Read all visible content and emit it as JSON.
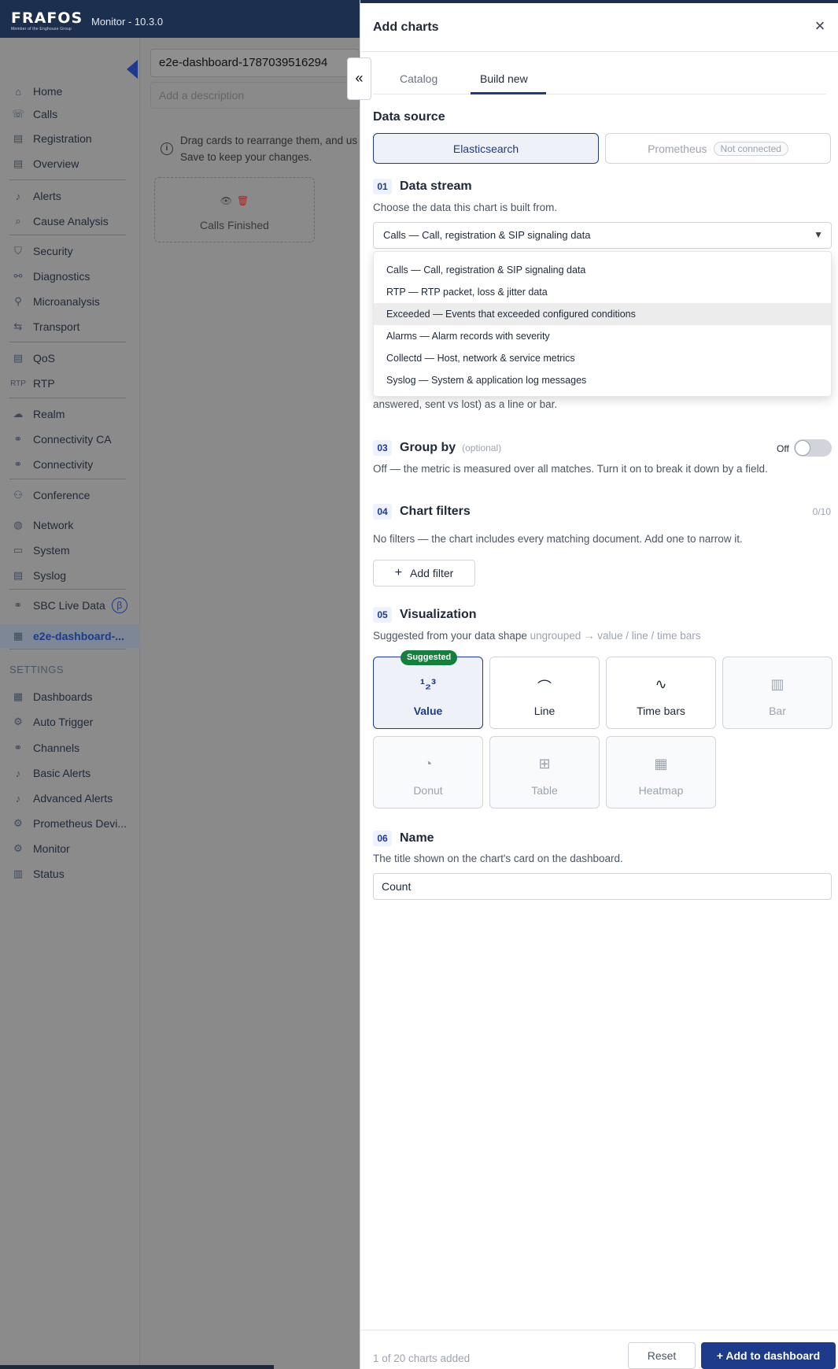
{
  "app": {
    "logo": "FRAFOS",
    "logo_sub": "Member of the Enghouse Group",
    "version": "Monitor - 10.3.0"
  },
  "sidebar": {
    "items": [
      {
        "label": "Home",
        "icon": "home-icon"
      },
      {
        "label": "Calls",
        "icon": "phone-icon"
      },
      {
        "label": "Registration",
        "icon": "registration-icon"
      },
      {
        "label": "Overview",
        "icon": "overview-icon"
      },
      {
        "label": "Alerts",
        "icon": "bell-icon"
      },
      {
        "label": "Cause Analysis",
        "icon": "search-icon"
      },
      {
        "label": "Security",
        "icon": "shield-icon"
      },
      {
        "label": "Diagnostics",
        "icon": "diagnostics-icon"
      },
      {
        "label": "Microanalysis",
        "icon": "microanalysis-icon"
      },
      {
        "label": "Transport",
        "icon": "transport-icon"
      },
      {
        "label": "QoS",
        "icon": "qos-icon"
      },
      {
        "label": "RTP",
        "icon": "rtp-icon"
      },
      {
        "label": "Realm",
        "icon": "cloud-icon"
      },
      {
        "label": "Connectivity CA",
        "icon": "connectivity-icon"
      },
      {
        "label": "Connectivity",
        "icon": "connectivity-icon"
      },
      {
        "label": "Conference",
        "icon": "conference-icon"
      },
      {
        "label": "Network",
        "icon": "globe-icon"
      },
      {
        "label": "System",
        "icon": "monitor-icon"
      },
      {
        "label": "Syslog",
        "icon": "log-icon"
      },
      {
        "label": "SBC Live Data",
        "icon": "live-data-icon",
        "badge": "β"
      },
      {
        "label": "e2e-dashboard-...",
        "icon": "dashboard-icon"
      }
    ],
    "settings_header": "SETTINGS",
    "settings_items": [
      {
        "label": "Dashboards",
        "icon": "dashboard-icon"
      },
      {
        "label": "Auto Trigger",
        "icon": "gear-icon"
      },
      {
        "label": "Channels",
        "icon": "channels-icon"
      },
      {
        "label": "Basic Alerts",
        "icon": "bell-icon"
      },
      {
        "label": "Advanced Alerts",
        "icon": "bell-icon"
      },
      {
        "label": "Prometheus Devi...",
        "icon": "gear-icon"
      },
      {
        "label": "Monitor",
        "icon": "gear-icon"
      },
      {
        "label": "Status",
        "icon": "status-icon"
      }
    ]
  },
  "main": {
    "dashboard_title": "e2e-dashboard-1787039516294",
    "description_placeholder": "Add a description",
    "hint_line1": "Drag cards to rearrange them, and us",
    "hint_line2": "Save to keep your changes.",
    "placeholder_card_label": "Calls Finished",
    "drawer_toggle": "«"
  },
  "drawer": {
    "title": "Add charts",
    "close": "×",
    "tabs": [
      "Catalog",
      "Build new"
    ],
    "active_tab": "Build new",
    "data_source": {
      "heading": "Data source",
      "elasticsearch": "Elasticsearch",
      "prometheus": "Prometheus",
      "prometheus_badge": "Not connected"
    },
    "data_stream": {
      "step": "01",
      "heading": "Data stream",
      "subtitle": "Choose the data this chart is built from.",
      "selected": "Calls — Call, registration & SIP signaling data",
      "options": [
        "Calls — Call, registration & SIP signaling data",
        "RTP — RTP packet, loss & jitter data",
        "Exceeded — Events that exceeded configured conditions",
        "Alarms — Alarm records with severity",
        "Collectd — Host, network & service metrics",
        "Syslog — System & application log messages"
      ],
      "highlighted_index": 2
    },
    "metric_peek": "answered, sent vs lost) as a line or bar.",
    "group_by": {
      "step": "03",
      "heading": "Group by",
      "optional": "(optional)",
      "toggle_label": "Off",
      "subtitle": "Off — the metric is measured over all matches. Turn it on to break it down by a field."
    },
    "chart_filters": {
      "step": "04",
      "heading": "Chart filters",
      "count": "0/10",
      "subtitle": "No filters — the chart includes every matching document. Add one to narrow it.",
      "add_filter": "Add filter",
      "add_icon": "+"
    },
    "visualization": {
      "step": "05",
      "heading": "Visualization",
      "suggested_prefix": "Suggested from your data shape",
      "suggested_shape": "ungrouped → value / line / time bars",
      "suggested_badge": "Suggested",
      "options": [
        {
          "label": "Value",
          "icon": "value-icon",
          "glyph": "¹₂³",
          "state": "selected"
        },
        {
          "label": "Line",
          "icon": "line-chart-icon",
          "glyph": "⌒",
          "state": "enabled"
        },
        {
          "label": "Time bars",
          "icon": "time-bars-icon",
          "glyph": "∿",
          "state": "enabled"
        },
        {
          "label": "Bar",
          "icon": "bar-chart-icon",
          "glyph": "▥",
          "state": "disabled"
        },
        {
          "label": "Donut",
          "icon": "donut-icon",
          "glyph": "◔",
          "state": "disabled"
        },
        {
          "label": "Table",
          "icon": "table-icon",
          "glyph": "⊞",
          "state": "disabled"
        },
        {
          "label": "Heatmap",
          "icon": "heatmap-icon",
          "glyph": "▦",
          "state": "disabled"
        }
      ]
    },
    "name": {
      "step": "06",
      "heading": "Name",
      "subtitle": "The title shown on the chart's card on the dashboard.",
      "value": "Count"
    },
    "footer": {
      "count": "1 of 20 charts added",
      "reset": "Reset",
      "add": "Add to dashboard",
      "add_icon": "+"
    }
  },
  "colors": {
    "brand_navy": "#1e3a8a",
    "header_bg": "#1d2f4e",
    "suggested_green": "#15803d"
  }
}
